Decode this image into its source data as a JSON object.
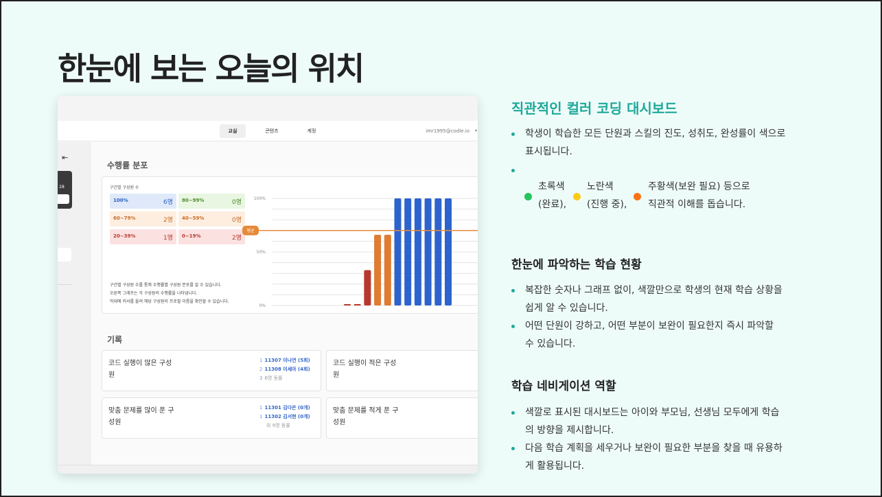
{
  "slide": {
    "title": "한눈에 보는 오늘의 위치"
  },
  "screenshot": {
    "nav": {
      "tabs": [
        "교실",
        "콘텐츠",
        "계정"
      ],
      "email": "imr1995@codle.io"
    },
    "sidebar": {
      "badge_number": "28"
    },
    "distribution": {
      "section_title": "수행률 분포",
      "panel_subtitle": "구간별 구성원 수",
      "bins": [
        {
          "range": "100%",
          "count": "6명"
        },
        {
          "range": "80~99%",
          "count": "0명"
        },
        {
          "range": "60~79%",
          "count": "2명"
        },
        {
          "range": "40~59%",
          "count": "0명"
        },
        {
          "range": "20~39%",
          "count": "1명"
        },
        {
          "range": "0~19%",
          "count": "2명"
        }
      ],
      "description": [
        "구간별 구성원 수를 통해 수행률별 구성원 분포를 알 수 있습니다.",
        "오른쪽 그래프는 각 구성원의 수행률을 나타냅니다.",
        "막대에 커서를 올려 해당 구성원의 프로필 이름을 확인할 수 있습니다."
      ]
    },
    "records": {
      "section_title": "기록",
      "cards": [
        {
          "title": "코드 실행이 많은 구성원",
          "list": [
            {
              "rank": "1",
              "name": "11307 이나연 (5회)"
            },
            {
              "rank": "2",
              "name": "11308 이세아 (4회)"
            },
            {
              "rank": "3",
              "name": "6명 동률"
            }
          ]
        },
        {
          "title": "코드 실행이 적은 구성원",
          "list": []
        },
        {
          "title": "맞춤 문제를 많이 푼 구성원",
          "list": [
            {
              "rank": "1",
              "name": "11301 김다은 (0개)"
            },
            {
              "rank": "1",
              "name": "11302 김서현 (0개)"
            },
            {
              "rank": "",
              "name": "외 9명 동률"
            }
          ]
        },
        {
          "title": "맞춤 문제를 적게 푼 구성원",
          "list": []
        }
      ]
    }
  },
  "chart_data": {
    "type": "bar",
    "ylim": [
      0,
      100
    ],
    "yticks": [
      "100%",
      "50%",
      "0%"
    ],
    "average_label": "평균",
    "average_value": 70,
    "values": [
      1,
      1,
      33,
      66,
      66,
      100,
      100,
      100,
      100,
      100,
      100
    ],
    "colors": [
      "#b53a2b",
      "#b53a2b",
      "#b53a2b",
      "#e07b32",
      "#e07b32",
      "#2d63cc",
      "#2d63cc",
      "#2d63cc",
      "#2d63cc",
      "#2d63cc",
      "#2d63cc"
    ],
    "average_color": "#e58a3a"
  },
  "right": {
    "sections": [
      {
        "heading": "직관적인 컬러 코딩 대시보드"
      },
      {
        "heading": "한눈에 파악하는 학습 현황"
      },
      {
        "heading": "학습 네비게이션 역할"
      }
    ],
    "s1_b1_l1": "학생이 학습한 모든 단원과 스킬의 진도, 성취도, 완성률이 색으로",
    "s1_b1_l2": "표시됩니다.",
    "legend": [
      {
        "l1": "초록색",
        "l2": "(완료),",
        "color": "#22c55e"
      },
      {
        "l1": "노란색",
        "l2": "(진행 중),",
        "color": "#facc15"
      },
      {
        "l1": "주황색(보완 필요) 등으로",
        "l2": "직관적 이해를 돕습니다.",
        "color": "#f97316"
      }
    ],
    "s2_b1_l1": "복잡한 숫자나 그래프 없이, 색깔만으로 학생의 현재 학습 상황을",
    "s2_b1_l2": "쉽게 알 수 있습니다.",
    "s2_b2_l1": "어떤 단원이 강하고, 어떤 부분이 보완이 필요한지 즉시 파악할",
    "s2_b2_l2": "수 있습니다.",
    "s3_b1_l1": "색깔로 표시된 대시보드는 아이와 부모님, 선생님 모두에게 학습",
    "s3_b1_l2": "의 방향을 제시합니다.",
    "s3_b2_l1": "다음 학습 계획을 세우거나 보완이 필요한 부분을 찾을 때 유용하",
    "s3_b2_l2": "게 활용됩니다."
  }
}
